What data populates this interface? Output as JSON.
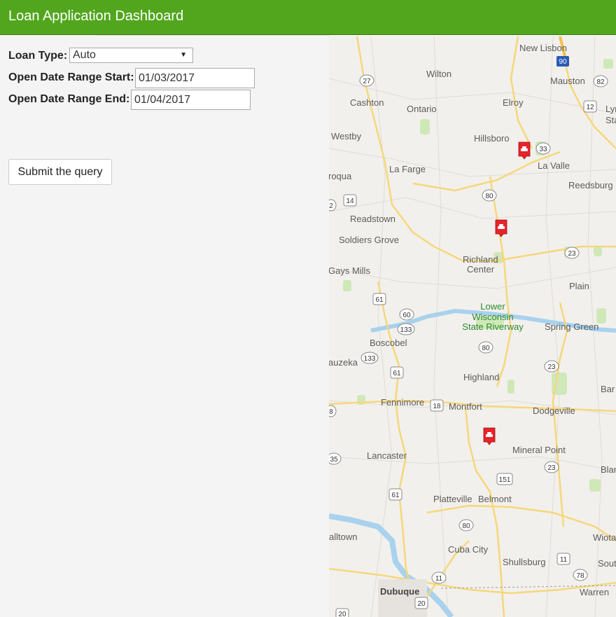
{
  "header": {
    "title": "Loan Application Dashboard"
  },
  "form": {
    "loan_type_label": "Loan Type:",
    "loan_type_value": "Auto",
    "start_label": "Open Date Range Start:",
    "start_value": "01/03/2017",
    "end_label": "Open Date Range End:",
    "end_value": "01/04/2017",
    "submit_label": "Submit the query"
  },
  "map": {
    "colors": {
      "land": "#f2f0ec",
      "road": "#f6d77a",
      "minor": "#e0dcd3",
      "water": "#a8d2ee",
      "park": "#cfe8b8",
      "marker": "#e8232a"
    },
    "places": [
      "New Lisbon",
      "Mauston",
      "Lyn",
      "Sta",
      "Wilton",
      "Cashton",
      "Ontario",
      "Elroy",
      "Westby",
      "Hillsboro",
      "La Valle",
      "roqua",
      "La Farge",
      "Reedsburg",
      "Readstown",
      "Soldiers Grove",
      "Richland",
      "Center",
      "Gays Mills",
      "Plain",
      "Boscobel",
      "Spring Green",
      "auzeka",
      "Highland",
      "Bar",
      "Fennimore",
      "Montfort",
      "Dodgeville",
      "Mineral Point",
      "Lancaster",
      "Blan",
      "Platteville",
      "Belmont",
      "alltown",
      "Wiota",
      "Cuba City",
      "Shullsburg",
      "Sout",
      "Dubuque",
      "Warren"
    ],
    "park_label": [
      "Lower",
      "Wisconsin",
      "State Riverway"
    ],
    "highways": [
      "90",
      "82",
      "27",
      "12",
      "33",
      "80",
      "14",
      "2",
      "23",
      "61",
      "60",
      "133",
      "133",
      "80",
      "23",
      "61",
      "18",
      "8",
      "35",
      "151",
      "23",
      "61",
      "80",
      "11",
      "78",
      "20",
      "11",
      "20"
    ],
    "markers": [
      "car-marker-icon",
      "car-marker-icon",
      "car-marker-icon"
    ]
  }
}
